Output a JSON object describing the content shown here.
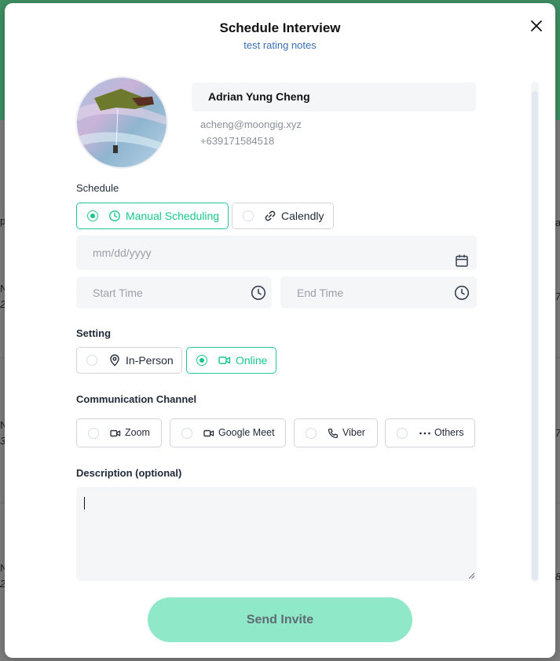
{
  "background": {
    "fragments": [
      {
        "id": "frag-1",
        "text": "p"
      },
      {
        "id": "frag-2",
        "text": "N"
      },
      {
        "id": "frag-3",
        "text": "2"
      },
      {
        "id": "frag-4",
        "text": "N"
      },
      {
        "id": "frag-5",
        "text": "3"
      },
      {
        "id": "frag-6",
        "text": "N"
      },
      {
        "id": "frag-7",
        "text": "2"
      },
      {
        "id": "frag-8",
        "text": "a"
      },
      {
        "id": "frag-9",
        "text": "7"
      },
      {
        "id": "frag-10",
        "text": "7"
      },
      {
        "id": "frag-11",
        "text": "8"
      }
    ]
  },
  "modal": {
    "title": "Schedule Interview",
    "subtitle": "test rating notes",
    "close_icon": "close-icon"
  },
  "candidate": {
    "name": "Adrian Yung Cheng",
    "email": "acheng@moongig.xyz",
    "phone": "+639171584518"
  },
  "schedule": {
    "label": "Schedule",
    "options": [
      {
        "label": "Manual Scheduling",
        "icon": "clock-icon",
        "selected": true
      },
      {
        "label": "Calendly",
        "icon": "link-icon",
        "selected": false
      }
    ],
    "date_placeholder": "mm/dd/yyyy",
    "start_time_placeholder": "Start Time",
    "end_time_placeholder": "End Time"
  },
  "setting": {
    "label": "Setting",
    "options": [
      {
        "label": "In-Person",
        "icon": "location-pin-icon",
        "selected": false
      },
      {
        "label": "Online",
        "icon": "video-icon",
        "selected": true
      }
    ]
  },
  "communication": {
    "label": "Communication Channel",
    "options": [
      {
        "label": "Zoom",
        "icon": "video-icon"
      },
      {
        "label": "Google Meet",
        "icon": "video-icon"
      },
      {
        "label": "Viber",
        "icon": "phone-icon"
      },
      {
        "label": "Others",
        "icon": "ellipsis-icon"
      }
    ]
  },
  "description": {
    "label": "Description (optional)",
    "value": ""
  },
  "actions": {
    "send_label": "Send Invite"
  },
  "colors": {
    "accent": "#16c98a",
    "button_bg": "#8fe8c8",
    "subtitle": "#3b6fb6"
  }
}
